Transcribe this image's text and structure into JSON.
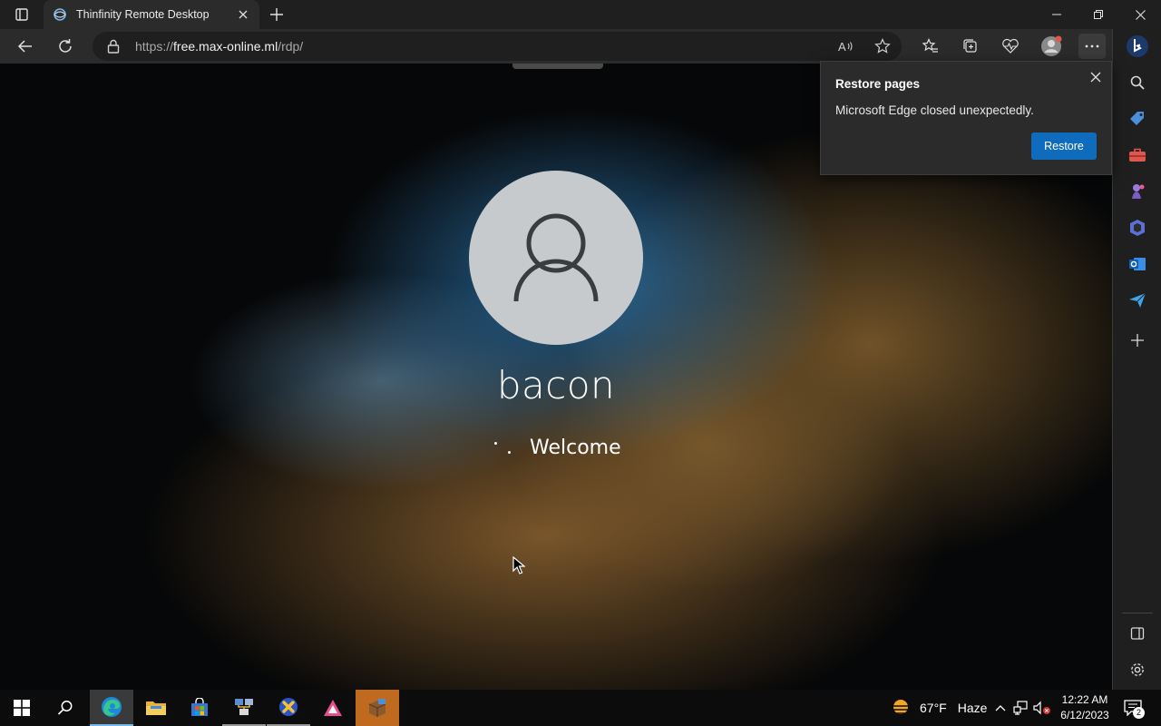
{
  "browser": {
    "tab": {
      "title": "Thinfinity Remote Desktop",
      "icon": "thinfinity-icon"
    },
    "address": {
      "scheme": "https://",
      "host": "free.max-online.ml",
      "path": "/rdp/"
    }
  },
  "restore_popup": {
    "title": "Restore pages",
    "message": "Microsoft Edge closed unexpectedly.",
    "button_label": "Restore"
  },
  "lockscreen": {
    "username": "bacon",
    "status": "Welcome"
  },
  "taskbar": {
    "apps": [
      "start-icon",
      "search-icon",
      "edge-icon",
      "file-explorer-icon",
      "store-icon",
      "network-app-icon",
      "x-app-icon",
      "triangle-app-icon",
      "package-app-icon"
    ],
    "weather": {
      "temp": "67°F",
      "condition": "Haze"
    },
    "clock": {
      "time": "12:22 AM",
      "date": "6/12/2023"
    },
    "notifications_count": "2"
  },
  "colors": {
    "accent": "#0f6cbd",
    "chrome": "#2b2b2b",
    "tabstrip": "#1f1f1f"
  }
}
